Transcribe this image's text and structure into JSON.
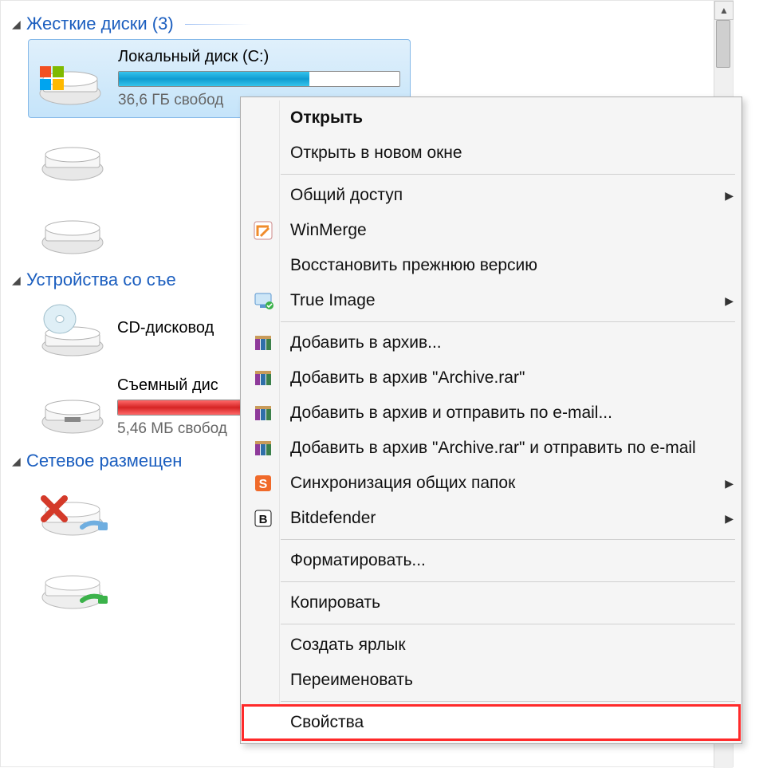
{
  "groups": {
    "hdd": {
      "label": "Жесткие диски (3)"
    },
    "removable": {
      "label": "Устройства со съе"
    },
    "network": {
      "label": "Сетевое размещен"
    }
  },
  "drives": {
    "c": {
      "name": "Локальный диск (C:)",
      "free_text": "36,6 ГБ свобод",
      "fill_percent": 68
    },
    "cd": {
      "name": "CD-дисковод"
    },
    "removable": {
      "name": "Съемный дис",
      "free_text": "5,46 МБ свобод",
      "fill_percent": 100
    }
  },
  "context_menu": {
    "open": "Открыть",
    "open_new": "Открыть в новом окне",
    "share": "Общий доступ",
    "winmerge": "WinMerge",
    "restore": "Восстановить прежнюю версию",
    "trueimage": "True Image",
    "archive_add": "Добавить в архив...",
    "archive_named": "Добавить в архив \"Archive.rar\"",
    "archive_email": "Добавить в архив и отправить по e-mail...",
    "archive_named_email": "Добавить в архив \"Archive.rar\" и отправить по e-mail",
    "sync_folders": "Синхронизация общих папок",
    "bitdefender": "Bitdefender",
    "format": "Форматировать...",
    "copy": "Копировать",
    "shortcut": "Создать ярлык",
    "rename": "Переименовать",
    "properties": "Свойства"
  },
  "icons": {
    "winmerge_color": "#f08c2c",
    "trueimage_color": "#2a78d3",
    "winrar_a": "#8e3a9a",
    "winrar_b": "#2f6fa8",
    "winrar_c": "#3b804a",
    "sync_color": "#f06a2a",
    "bitdefender_color": "#111"
  }
}
